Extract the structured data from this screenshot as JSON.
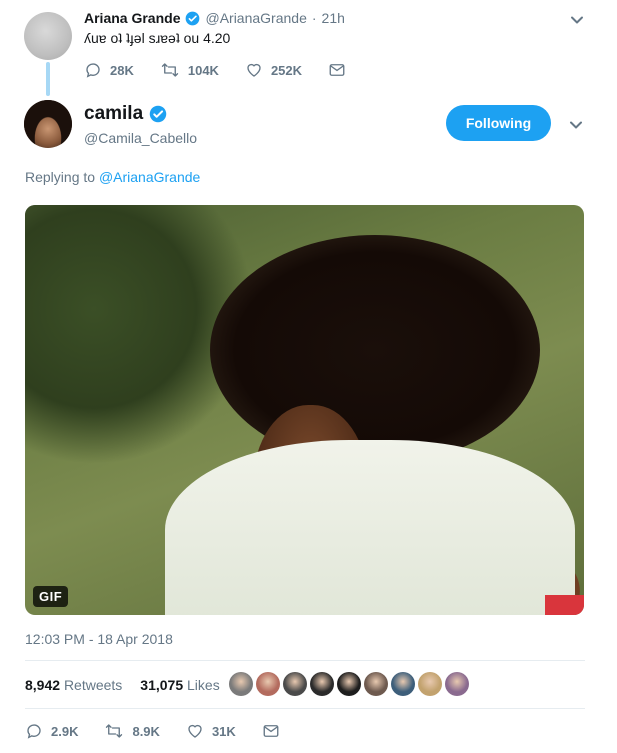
{
  "parent_tweet": {
    "name": "Ariana Grande",
    "handle": "@ArianaGrande",
    "separator": "·",
    "time": "21h",
    "text": "ʎuɐ oʇ ʇɟǝl sɹɐǝʇ ou 4.20",
    "replies": "28K",
    "retweets": "104K",
    "likes": "252K"
  },
  "main_tweet": {
    "name": "camila",
    "handle": "@Camila_Cabello",
    "follow_label": "Following",
    "replying_prefix": "Replying to",
    "replying_to": "@ArianaGrande",
    "media_badge": "GIF",
    "timestamp": "12:03 PM - 18 Apr 2018",
    "retweet_count": "8,942",
    "retweet_label": "Retweets",
    "like_count": "31,075",
    "like_label": "Likes",
    "replies": "2.9K",
    "retweets": "8.9K",
    "likes": "31K"
  },
  "liker_avatar_colors": [
    "#7a7a7a",
    "#b36b5e",
    "#4a4a4a",
    "#2b2b2b",
    "#1e1e1e",
    "#6e5a4f",
    "#3d5e7a",
    "#c2a26e",
    "#8a6a8f"
  ],
  "colors": {
    "accent": "#1da1f2",
    "muted": "#657786",
    "text": "#14171a",
    "divider": "#e6ecf0"
  },
  "icons": [
    "verified-badge-icon",
    "chevron-down-icon",
    "reply-icon",
    "retweet-icon",
    "like-icon",
    "message-icon"
  ]
}
